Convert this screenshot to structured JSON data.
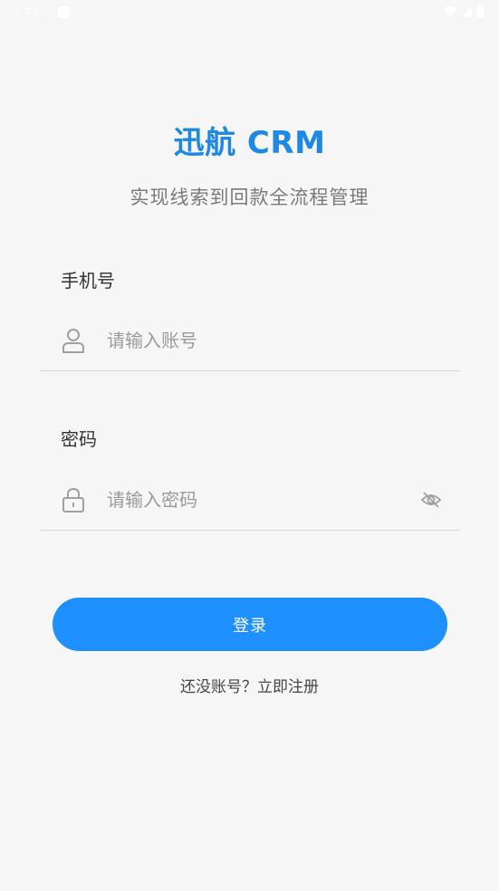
{
  "status_bar": {
    "time": "2:42",
    "icons": [
      "notification-icon",
      "wifi-icon",
      "signal-icon",
      "battery-icon"
    ]
  },
  "header": {
    "title": "迅航 CRM",
    "subtitle": "实现线索到回款全流程管理"
  },
  "form": {
    "phone": {
      "label": "手机号",
      "placeholder": "请输入账号",
      "value": "",
      "icon": "user-icon"
    },
    "password": {
      "label": "密码",
      "placeholder": "请输入密码",
      "value": "",
      "icon": "lock-icon",
      "toggle_icon": "eye-off-icon"
    }
  },
  "actions": {
    "login_label": "登录",
    "register_link": "还没账号？立即注册"
  },
  "colors": {
    "accent": "#1e90ff",
    "title": "#1e88e5",
    "background": "#f6f6f7"
  }
}
